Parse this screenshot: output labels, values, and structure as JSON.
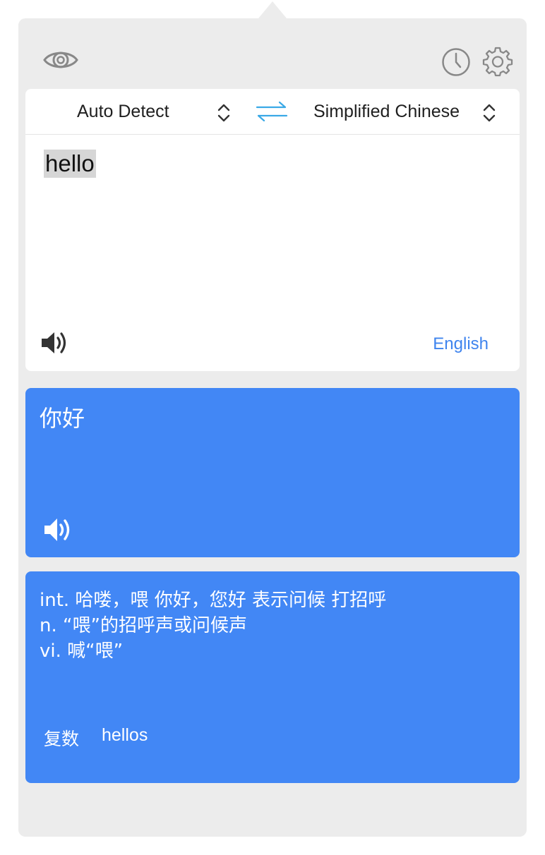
{
  "toolbar": {
    "eye_icon": "eye-icon",
    "history_icon": "clock-icon",
    "settings_icon": "gear-icon"
  },
  "languages": {
    "source": "Auto Detect",
    "target": "Simplified Chinese",
    "swap_icon": "swap-arrows-icon"
  },
  "input": {
    "text": "hello",
    "detected_language": "English",
    "speaker_icon": "speaker-icon"
  },
  "translation": {
    "text": "你好",
    "speaker_icon": "speaker-icon"
  },
  "dictionary": {
    "definitions": [
      "int. 哈喽，喂 你好，您好 表示问候 打招呼",
      "n. “喂”的招呼声或问候声",
      "vi. 喊“喂”"
    ],
    "plural_label": "复数",
    "plural_value": "hellos"
  },
  "colors": {
    "accent": "#4287f5",
    "link": "#3f84ee",
    "panel_bg": "#ececec",
    "swap_icon": "#3aa9e6"
  }
}
